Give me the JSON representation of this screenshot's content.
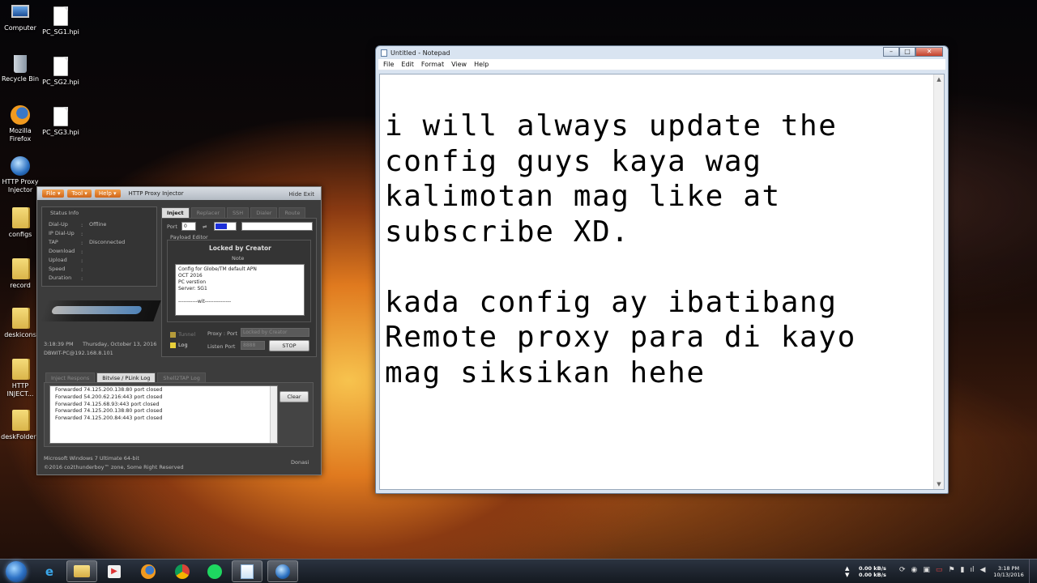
{
  "desktop": {
    "icons": [
      {
        "label": "Computer"
      },
      {
        "label": "PC_SG1.hpi"
      },
      {
        "label": "Recycle Bin"
      },
      {
        "label": "PC_SG2.hpi"
      },
      {
        "label": "Mozilla Firefox"
      },
      {
        "label": "PC_SG3.hpi"
      },
      {
        "label": "HTTP Proxy Injector"
      },
      {
        "label": "configs"
      },
      {
        "label": "record"
      },
      {
        "label": "deskicons"
      },
      {
        "label": "HTTP INJECT..."
      },
      {
        "label": "deskFolders"
      }
    ]
  },
  "notepad": {
    "title": "Untitled - Notepad",
    "menu": [
      "File",
      "Edit",
      "Format",
      "View",
      "Help"
    ],
    "content": "i will always update the\nconfig guys kaya wag\nkalimotan mag like at\nsubscribe XD.\n\nkada config ay ibatibang\nRemote proxy para di kayo\nmag siksikan hehe"
  },
  "injector": {
    "menu": [
      "File",
      "Tool",
      "Help"
    ],
    "title": "HTTP Proxy Injector",
    "hide": "Hide",
    "exit": "Exit",
    "status_title": "Status Info",
    "status": [
      {
        "k": "Dial-Up",
        "v": "Offline"
      },
      {
        "k": "IP Dial-Up",
        "v": ""
      },
      {
        "k": "TAP",
        "v": "Disconnected"
      },
      {
        "k": "Download",
        "v": ""
      },
      {
        "k": "Upload",
        "v": ""
      },
      {
        "k": "Speed",
        "v": ""
      },
      {
        "k": "Duration",
        "v": ""
      }
    ],
    "time": "3:18:39 PM",
    "date": "Thursday, October 13, 2016",
    "host": "DBWIT-PC@192.168.8.101",
    "tabs": [
      "Inject",
      "Replacer",
      "SSH",
      "Dialer",
      "Route"
    ],
    "port_label": "Port",
    "port_value": "0",
    "payload_label": "Payload Editor",
    "locked": "Locked by Creator",
    "note": "Note",
    "note_text": "Config for Globe/TM default APN\nOCT 2016\nPC verstion\nServer: SG1\n\n-----------wit---------------",
    "tunnel": "Tunnel",
    "log": "Log",
    "proxy_port_label": "Proxy : Port",
    "proxy_port_value": "Locked by Creator",
    "listen_label": "Listen Port",
    "listen_value": "8888",
    "stop": "STOP",
    "log_tabs": [
      "Inject Respons",
      "Bitvise / PLink Log",
      "Shell2TAP Log"
    ],
    "log_lines": [
      "Forwarded 74.125.200.138:80 port closed",
      "Forwarded 54.200.62.216:443 port closed",
      "Forwarded 74.125.68.93:443 port closed",
      "Forwarded 74.125.200.138:80 port closed",
      "Forwarded 74.125.200.84:443 port closed"
    ],
    "clear": "Clear",
    "os": "Microsoft Windows 7 Ultimate  64-bit",
    "copyright": "©2016 co2thunderboy™ zone, Some Right Reserved",
    "donasi": "Donasi"
  },
  "taskbar": {
    "net_up": "0.00 kB/s",
    "net_down": "0.00 kB/s",
    "time": "3:18 PM",
    "date": "10/13/2016"
  },
  "colors": {
    "accent": "#d0661a",
    "taskbar": "#1b2029"
  }
}
